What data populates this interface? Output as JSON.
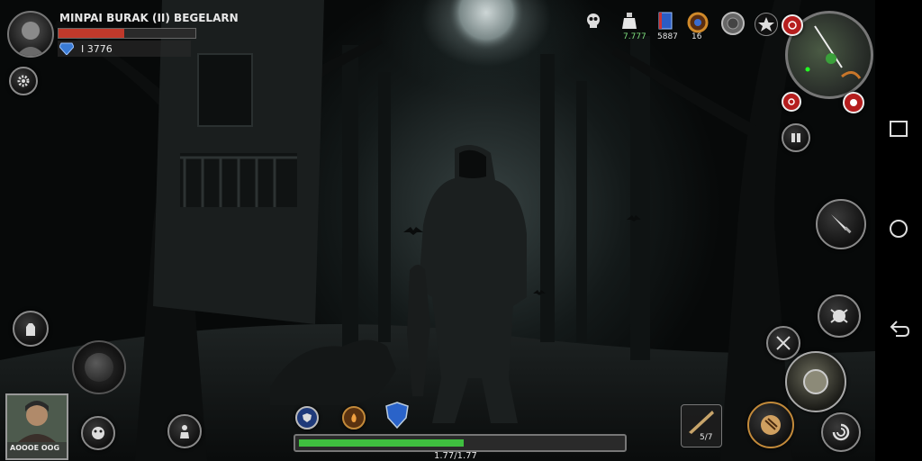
{
  "player": {
    "name": "MINPAI BURAK (II) BEGELARN",
    "level_value": "I 3776",
    "health_fraction": 0.48
  },
  "resources": [
    {
      "icon": "skull-icon",
      "value": ""
    },
    {
      "icon": "potion-icon",
      "value": "7.777"
    },
    {
      "icon": "book-icon",
      "value": "5887"
    },
    {
      "icon": "amulet-icon",
      "value": "16"
    },
    {
      "icon": "coin-icon",
      "value": ""
    }
  ],
  "companion": {
    "label": "AOOOE OOG"
  },
  "stamina": {
    "fraction": 0.51,
    "label": "1.77/1.77"
  },
  "weapon_slot": {
    "value": "5/7"
  },
  "colors": {
    "health": "#c0392b",
    "stamina": "#3fbf3f",
    "accent": "#c0392b"
  }
}
